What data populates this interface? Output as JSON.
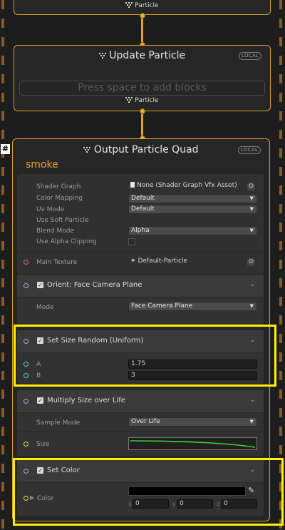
{
  "top_context": {
    "flow_label": "Particle"
  },
  "update_context": {
    "title": "Update Particle",
    "badge": "LOCAL",
    "placeholder": "Press space to add blocks",
    "flow_label": "Particle"
  },
  "output_context": {
    "hash_icon": "#",
    "title": "Output Particle Quad",
    "badge": "LOCAL",
    "name": "smoke",
    "settings": {
      "shader_graph_label": "Shader Graph",
      "shader_graph_value": "None (Shader Graph Vfx Asset)",
      "color_mapping_label": "Color Mapping",
      "color_mapping_value": "Default",
      "uv_mode_label": "Uv Mode",
      "uv_mode_value": "Default",
      "soft_particle_label": "Use Soft Particle",
      "blend_mode_label": "Blend Mode",
      "blend_mode_value": "Alpha",
      "alpha_clipping_label": "Use Alpha Clipping"
    },
    "main_texture_label": "Main Texture",
    "main_texture_value": "Default-Particle"
  },
  "blocks": {
    "orient": {
      "title": "Orient: Face Camera Plane",
      "mode_label": "Mode",
      "mode_value": "Face Camera Plane"
    },
    "set_size": {
      "title": "Set Size Random (Uniform)",
      "a_label": "A",
      "a_value": "1.75",
      "b_label": "B",
      "b_value": "3"
    },
    "multiply_size": {
      "title": "Multiply Size over Life",
      "sample_mode_label": "Sample Mode",
      "sample_mode_value": "Over Life",
      "size_label": "Size",
      "curve_color": "#3bd43b"
    },
    "set_color": {
      "title": "Set Color",
      "color_label": "Color",
      "color_value": "#000000",
      "x_label": "x",
      "x_value": "0",
      "y_label": "y",
      "y_value": "0",
      "z_label": "z",
      "z_value": "0"
    }
  },
  "colors": {
    "accent": "#e0a12b",
    "highlight": "#fff100"
  }
}
